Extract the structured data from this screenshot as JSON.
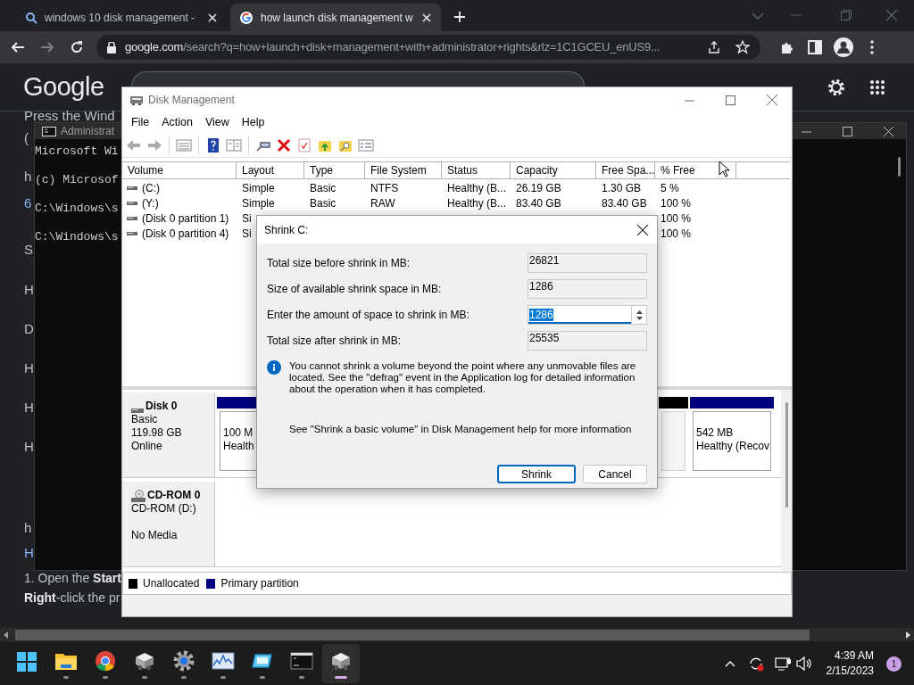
{
  "browser": {
    "tabs": [
      {
        "kind": "search",
        "title": "windows 10 disk management -",
        "selected": false
      },
      {
        "kind": "google",
        "title": "how launch disk management w",
        "selected": true
      }
    ],
    "url": {
      "host": "google.com",
      "path": "/search?q=how+launch+disk+management+with+administrator+rights&rlz=1C1GCEU_enUS9..."
    }
  },
  "google": {
    "logo": "Google"
  },
  "page_text": [
    {
      "text": "Press the Wind",
      "kind": "text"
    },
    {
      "text": "(",
      "kind": "text"
    },
    {
      "text": "h",
      "kind": "text"
    },
    {
      "text": "6",
      "kind": "link"
    },
    {
      "text": "S",
      "kind": "text"
    },
    {
      "text": "H",
      "kind": "text"
    },
    {
      "text": "D",
      "kind": "text"
    },
    {
      "text": "H",
      "kind": "text"
    },
    {
      "text": "H",
      "kind": "text"
    },
    {
      "text": "H",
      "kind": "text"
    },
    {
      "text": "h",
      "kind": "text"
    },
    {
      "text": "H",
      "kind": "link"
    },
    {
      "text": "1. Open the **Start**",
      "kind": "small"
    },
    {
      "text": "**Right**-click the pr",
      "kind": "small"
    }
  ],
  "cmd": {
    "title": "Administrat",
    "lines": [
      "Microsoft Wi",
      "(c) Microsof",
      "C:\\Windows\\s",
      "C:\\Windows\\s"
    ]
  },
  "disk_management": {
    "title": "Disk Management",
    "menu": [
      "File",
      "Action",
      "View",
      "Help"
    ],
    "columns": [
      "Volume",
      "Layout",
      "Type",
      "File System",
      "Status",
      "Capacity",
      "Free Spa...",
      "% Free"
    ],
    "rows": [
      [
        "(C:)",
        "Simple",
        "Basic",
        "NTFS",
        "Healthy (B...",
        "26.19 GB",
        "1.30 GB",
        "5 %"
      ],
      [
        "(Y:)",
        "Simple",
        "Basic",
        "RAW",
        "Healthy (B...",
        "83.40 GB",
        "83.40 GB",
        "100 %"
      ],
      [
        "(Disk 0 partition 1)",
        "Si",
        null,
        null,
        null,
        null,
        null,
        "100 %"
      ],
      [
        "(Disk 0 partition 4)",
        "Si",
        null,
        null,
        null,
        null,
        null,
        "100 %"
      ]
    ],
    "disks": [
      {
        "kind": "hdd",
        "name": "Disk 0",
        "lines": [
          "Basic",
          "119.98 GB",
          "Online"
        ],
        "partitions": [
          {
            "size": "100 M",
            "status": "Health",
            "color": "#000080"
          },
          {
            "color": "#000000"
          },
          {
            "size": "542 MB",
            "status": "Healthy (Recov",
            "color": "#000080"
          }
        ]
      },
      {
        "kind": "cdrom",
        "name": "CD-ROM 0",
        "lines": [
          "CD-ROM (D:)",
          "No Media"
        ]
      }
    ],
    "legend": [
      {
        "label": "Unallocated",
        "color": "#000000"
      },
      {
        "label": "Primary partition",
        "color": "#000080"
      }
    ]
  },
  "dialog": {
    "title": "Shrink C:",
    "fields": [
      {
        "kind": "readonly",
        "label": "Total size before shrink in MB:",
        "value": "26821"
      },
      {
        "kind": "readonly",
        "label": "Size of available shrink space in MB:",
        "value": "1286"
      },
      {
        "kind": "spin",
        "label": "Enter the amount of space to shrink in MB:",
        "value": "1286"
      },
      {
        "kind": "readonly",
        "label": "Total size after shrink in MB:",
        "value": "25535"
      }
    ],
    "info": "You cannot shrink a volume beyond the point where any unmovable files are located. See the \"defrag\" event in the Application log for detailed information about the operation when it has completed.",
    "help": "See \"Shrink a basic volume\" in Disk Management help for more information",
    "buttons": [
      {
        "label": "Shrink",
        "default": true
      },
      {
        "label": "Cancel",
        "default": false
      }
    ]
  },
  "taskbar": {
    "apps": [
      {
        "kind": "start",
        "selected": false
      },
      {
        "kind": "folder",
        "selected": false
      },
      {
        "kind": "chrome",
        "selected": false
      },
      {
        "kind": "disk",
        "selected": false
      },
      {
        "kind": "settings",
        "selected": false
      },
      {
        "kind": "monitor",
        "selected": false
      },
      {
        "kind": "display",
        "selected": false
      },
      {
        "kind": "terminal",
        "selected": false
      },
      {
        "kind": "disk",
        "selected": true
      }
    ],
    "time": "4:39 AM",
    "date": "2/15/2023",
    "notifications": "1"
  }
}
